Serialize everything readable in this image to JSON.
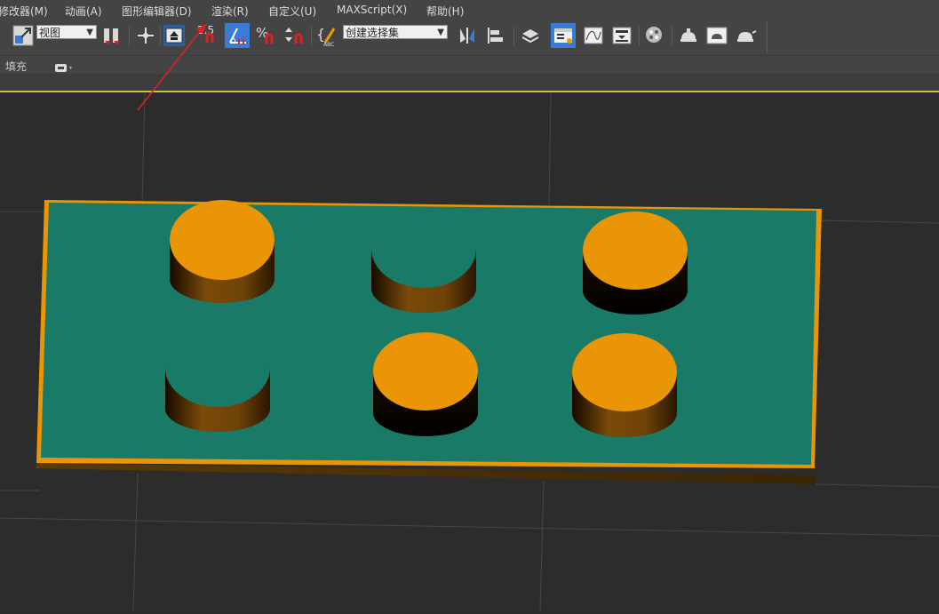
{
  "menu": {
    "items": [
      "修改器(M)",
      "动画(A)",
      "图形编辑器(D)",
      "渲染(R)",
      "自定义(U)",
      "MAXScript(X)",
      "帮助(H)"
    ]
  },
  "toolbar": {
    "view_select": "视图",
    "snap_value": "2.5",
    "selection_set": "创建选择集"
  },
  "ribbon": {
    "label": "填充"
  },
  "colors": {
    "ui_bg": "#444444",
    "viewport_bg": "#2c2c2c",
    "board_top": "#1a7a68",
    "orange": "#e99505",
    "active_border": "#c8c24a",
    "arrow": "#e02020"
  },
  "annotation": {
    "arrow_points_to": "渲染(R)"
  },
  "scene": {
    "objects": [
      "board",
      "cylinder-1",
      "cylinder-2",
      "cylinder-3",
      "cylinder-4",
      "cylinder-5",
      "cylinder-6"
    ]
  }
}
